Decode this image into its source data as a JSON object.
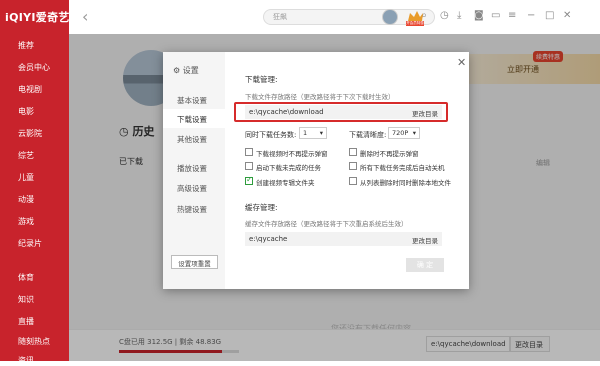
{
  "app": {
    "logo": "iQIYI爱奇艺"
  },
  "sidebar": {
    "items": [
      "推荐",
      "会员中心",
      "电视剧",
      "电影",
      "云影院",
      "综艺",
      "儿童",
      "动漫",
      "游戏",
      "纪录片",
      "体育",
      "知识",
      "直播",
      "随刻热点",
      "资讯"
    ]
  },
  "topbar": {
    "search_placeholder": "狂飙",
    "search_icon": "search-icon",
    "vip_badge": "开会员特惠"
  },
  "main": {
    "banner_button": "立即开通",
    "banner_tag": "续费特惠",
    "history": "历史",
    "downloaded": "已下载",
    "edit": "编辑",
    "empty_hint": "您还没有下载任何内容",
    "disk_used": "C盘已用 312.5G",
    "disk_free": "剩余 48.83G",
    "disk_fraction": 0.86,
    "path_value": "e:\\qycache\\download",
    "path_button": "更改目录"
  },
  "dialog": {
    "title": "设置",
    "tabs": [
      "基本设置",
      "下载设置",
      "其他设置",
      "播放设置",
      "高级设置",
      "热键设置"
    ],
    "active_tab": 1,
    "reset_button": "设置项重置",
    "download": {
      "heading": "下载管理:",
      "path_label": "下载文件存放路径（更改路径将于下次下载时生效）",
      "path_value": "e:\\qycache\\download",
      "path_button": "更改目录",
      "tasks_label": "同时下载任务数:",
      "tasks_value": "1",
      "quality_label": "下载清晰度:",
      "quality_value": "720P",
      "options": [
        {
          "label": "下载视频时不再提示弹窗",
          "checked": false
        },
        {
          "label": "删除时不再提示弹窗",
          "checked": false
        },
        {
          "label": "启动下载未完成的任务",
          "checked": false
        },
        {
          "label": "所有下载任务完成后自动关机",
          "checked": false
        },
        {
          "label": "创建视频专辑文件夹",
          "checked": true
        },
        {
          "label": "从列表删除时同时删除本地文件",
          "checked": false
        }
      ]
    },
    "cache": {
      "heading": "缓存管理:",
      "path_label": "缓存文件存放路径（更改路径将于下次重启系统后生效）",
      "path_value": "e:\\qycache",
      "path_button": "更改目录"
    },
    "ok_button": "确 定"
  }
}
